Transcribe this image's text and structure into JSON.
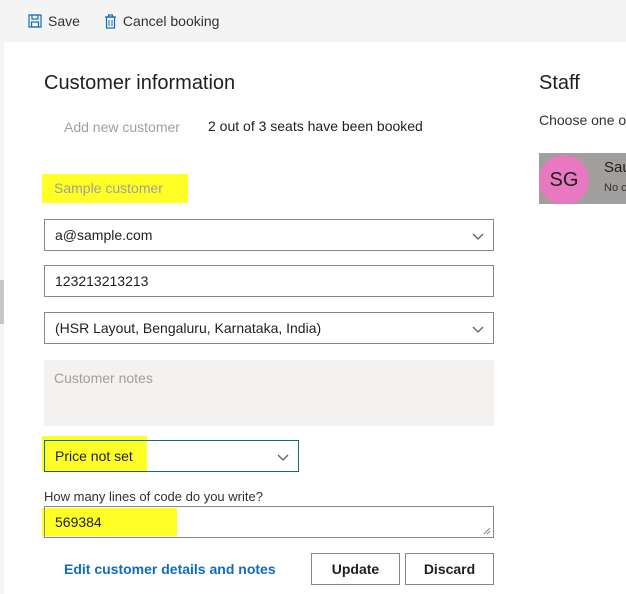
{
  "toolbar": {
    "save_label": "Save",
    "cancel_label": "Cancel booking"
  },
  "customer": {
    "title": "Customer information",
    "add_new_label": "Add new customer",
    "seats_text": "2 out of 3 seats have been booked",
    "name_placeholder": "Sample customer",
    "email_value": "a@sample.com",
    "phone_value": "123213213213",
    "address_value": "(HSR Layout, Bengaluru, Karnataka, India)",
    "notes_placeholder": "Customer notes",
    "price_value": "Price not set",
    "question_label": "How many lines of code do you write?",
    "code_value": "569384",
    "edit_link": "Edit customer details and notes",
    "update_label": "Update",
    "discard_label": "Discard"
  },
  "staff": {
    "title": "Staff",
    "hint": "Choose one or",
    "initials": "SG",
    "name": "Sau",
    "sub": "No c"
  },
  "colors": {
    "highlight": "#ffff00",
    "avatar": "#e879c0",
    "link": "#0f6cbd",
    "focus_border": "#106e6e"
  }
}
